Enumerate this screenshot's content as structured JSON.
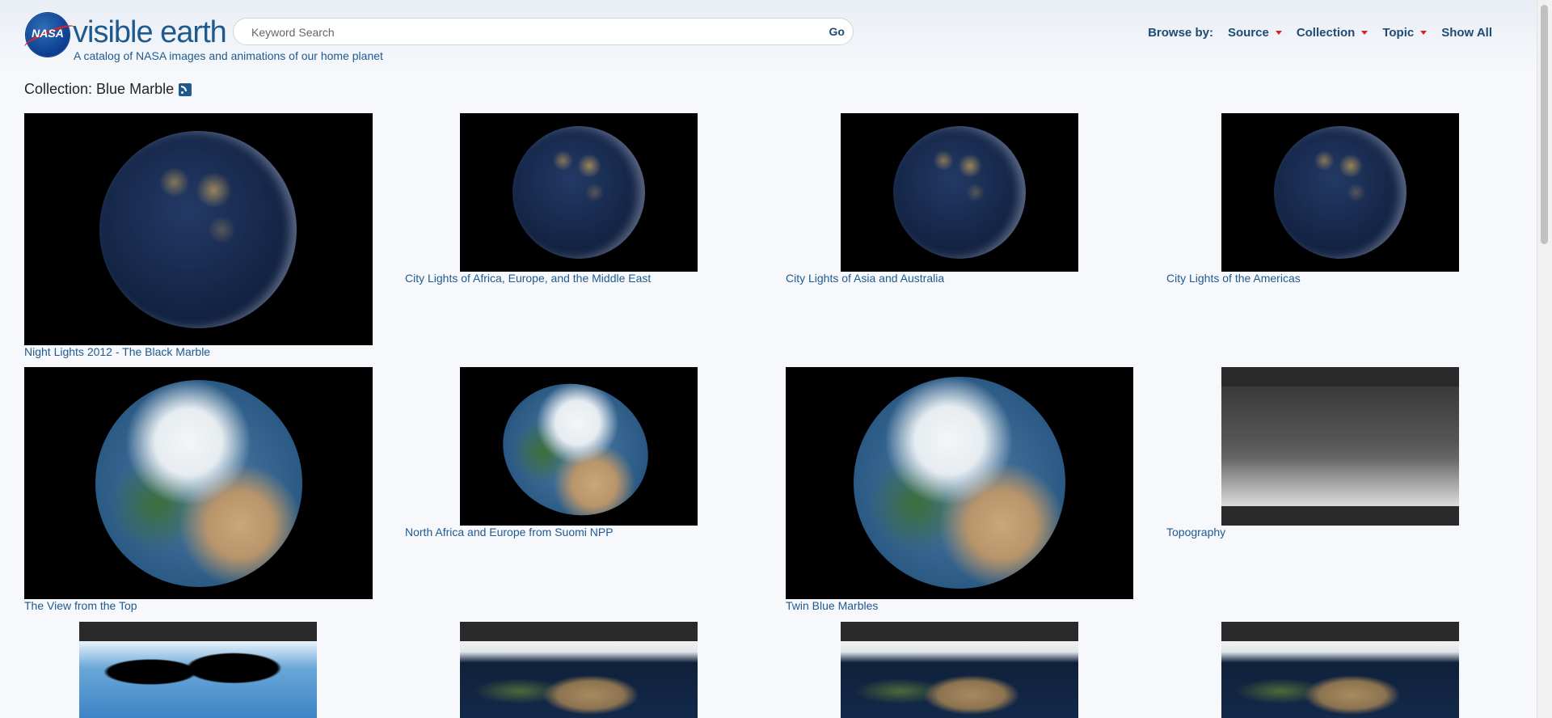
{
  "site": {
    "logo_text": "visible earth",
    "logo_badge": "NASA",
    "tagline": "A catalog of NASA images and animations of our home planet"
  },
  "search": {
    "placeholder": "Keyword Search",
    "go_label": "Go"
  },
  "nav": {
    "browse_label": "Browse by:",
    "items": [
      {
        "label": "Source",
        "has_caret": true
      },
      {
        "label": "Collection",
        "has_caret": true
      },
      {
        "label": "Topic",
        "has_caret": true
      },
      {
        "label": "Show All",
        "has_caret": false
      }
    ]
  },
  "page": {
    "title": "Collection: Blue Marble",
    "rss_icon": "rss-icon"
  },
  "gallery": [
    {
      "caption": "Night Lights 2012 - The Black Marble"
    },
    {
      "caption": "City Lights of Africa, Europe, and the Middle East"
    },
    {
      "caption": "City Lights of Asia and Australia"
    },
    {
      "caption": "City Lights of the Americas"
    },
    {
      "caption": "The View from the Top"
    },
    {
      "caption": "North Africa and Europe from Suomi NPP"
    },
    {
      "caption": "Twin Blue Marbles"
    },
    {
      "caption": "Topography"
    },
    {
      "caption": ""
    },
    {
      "caption": ""
    },
    {
      "caption": ""
    },
    {
      "caption": ""
    }
  ],
  "colors": {
    "link": "#1f5a8f",
    "nav": "#1f4b73",
    "caret": "#d2232a",
    "background": "#f6f8fb"
  }
}
